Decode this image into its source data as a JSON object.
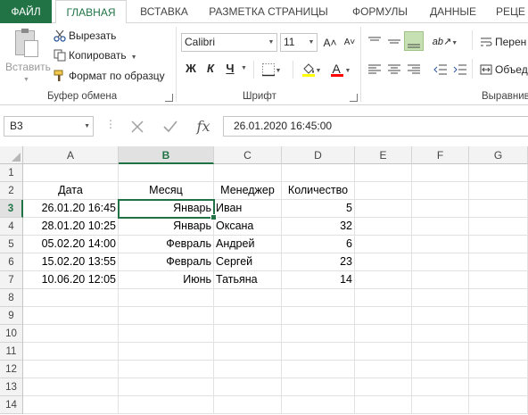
{
  "tabs": {
    "file": "ФАЙЛ",
    "home": "ГЛАВНАЯ",
    "insert": "ВСТАВКА",
    "page_layout": "РАЗМЕТКА СТРАНИЦЫ",
    "formulas": "ФОРМУЛЫ",
    "data": "ДАННЫЕ",
    "review": "РЕЦЕ"
  },
  "ribbon": {
    "clipboard": {
      "paste": "Вставить",
      "cut": "Вырезать",
      "copy": "Копировать",
      "format_painter": "Формат по образцу",
      "group_label": "Буфер обмена"
    },
    "font": {
      "font_name": "Calibri",
      "font_size": "11",
      "grow": "A˄",
      "shrink": "A˅",
      "bold": "Ж",
      "italic": "К",
      "underline": "Ч",
      "font_color_glyph": "A",
      "group_label": "Шрифт"
    },
    "alignment": {
      "wrap": "Перен",
      "merge": "Объед",
      "group_label": "Выравнив"
    }
  },
  "formula_bar": {
    "name_box": "B3",
    "fx": "fx",
    "content": "26.01.2020  16:45:00"
  },
  "grid": {
    "columns": [
      "A",
      "B",
      "C",
      "D",
      "E",
      "F",
      "G"
    ],
    "rows": [
      "1",
      "2",
      "3",
      "4",
      "5",
      "6",
      "7",
      "8",
      "9",
      "10",
      "11",
      "12",
      "13",
      "14"
    ],
    "selected_column": "B",
    "selected_row": "3",
    "headers": [
      "Дата",
      "Месяц",
      "Менеджер",
      "Количество"
    ],
    "data": [
      [
        "26.01.20 16:45",
        "Январь",
        "Иван",
        "5"
      ],
      [
        "28.01.20 10:25",
        "Январь",
        "Оксана",
        "32"
      ],
      [
        "05.02.20 14:00",
        "Февраль",
        "Андрей",
        "6"
      ],
      [
        "15.02.20 13:55",
        "Февраль",
        "Сергей",
        "23"
      ],
      [
        "10.06.20 12:05",
        "Июнь",
        "Татьяна",
        "14"
      ]
    ]
  },
  "colors": {
    "accent": "#217346",
    "selected_fill": "#c6e0b4",
    "font_color_bar": "#ff0000",
    "highlight_bar": "#ffff00"
  }
}
